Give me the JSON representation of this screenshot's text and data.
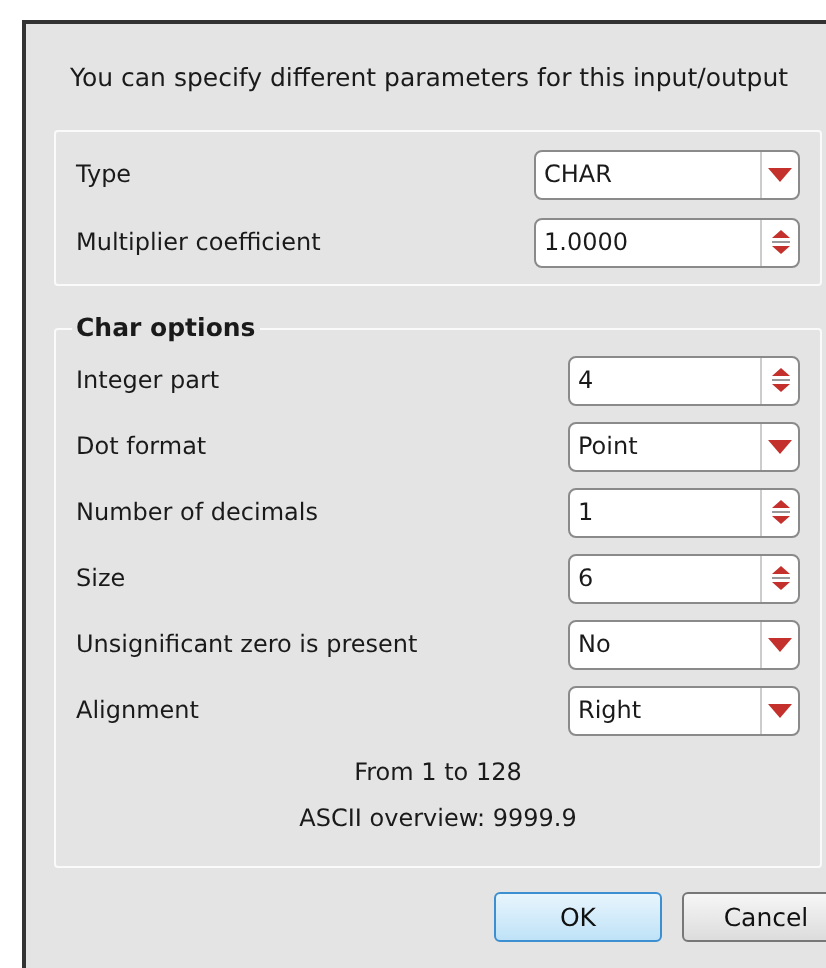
{
  "intro": "You can specify different parameters for this input/output",
  "general": {
    "rows": [
      {
        "label": "Type",
        "kind": "combo",
        "value": "CHAR"
      },
      {
        "label": "Multiplier coefficient",
        "kind": "spin",
        "value": "1.0000"
      }
    ]
  },
  "char_options": {
    "title": "Char options",
    "rows": [
      {
        "label": "Integer part",
        "kind": "spin",
        "value": "4"
      },
      {
        "label": "Dot format",
        "kind": "combo",
        "value": "Point"
      },
      {
        "label": "Number of decimals",
        "kind": "spin",
        "value": "1"
      },
      {
        "label": "Size",
        "kind": "spin",
        "value": "6"
      },
      {
        "label": "Unsignificant zero is present",
        "kind": "combo",
        "value": "No"
      },
      {
        "label": "Alignment",
        "kind": "combo",
        "value": "Right"
      }
    ],
    "notes": [
      "From 1 to 128",
      "ASCII overview: 9999.9"
    ]
  },
  "buttons": [
    {
      "label": "OK",
      "default": true
    },
    {
      "label": "Cancel",
      "default": false
    }
  ]
}
